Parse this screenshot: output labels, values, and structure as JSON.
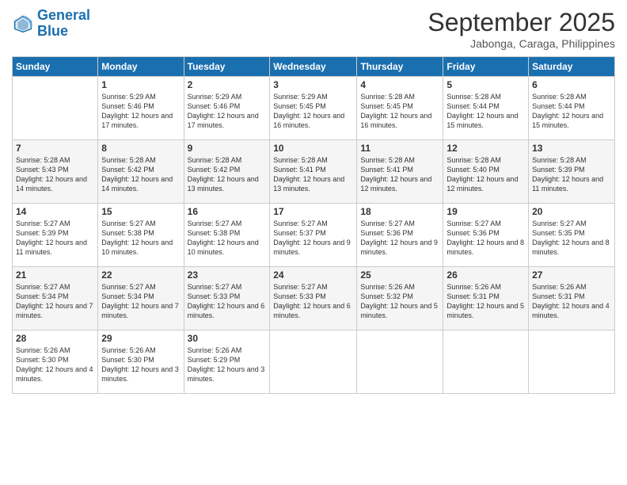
{
  "header": {
    "logo_line1": "General",
    "logo_line2": "Blue",
    "month": "September 2025",
    "location": "Jabonga, Caraga, Philippines"
  },
  "days_of_week": [
    "Sunday",
    "Monday",
    "Tuesday",
    "Wednesday",
    "Thursday",
    "Friday",
    "Saturday"
  ],
  "weeks": [
    [
      {
        "day": "",
        "sunrise": "",
        "sunset": "",
        "daylight": ""
      },
      {
        "day": "1",
        "sunrise": "Sunrise: 5:29 AM",
        "sunset": "Sunset: 5:46 PM",
        "daylight": "Daylight: 12 hours and 17 minutes."
      },
      {
        "day": "2",
        "sunrise": "Sunrise: 5:29 AM",
        "sunset": "Sunset: 5:46 PM",
        "daylight": "Daylight: 12 hours and 17 minutes."
      },
      {
        "day": "3",
        "sunrise": "Sunrise: 5:29 AM",
        "sunset": "Sunset: 5:45 PM",
        "daylight": "Daylight: 12 hours and 16 minutes."
      },
      {
        "day": "4",
        "sunrise": "Sunrise: 5:28 AM",
        "sunset": "Sunset: 5:45 PM",
        "daylight": "Daylight: 12 hours and 16 minutes."
      },
      {
        "day": "5",
        "sunrise": "Sunrise: 5:28 AM",
        "sunset": "Sunset: 5:44 PM",
        "daylight": "Daylight: 12 hours and 15 minutes."
      },
      {
        "day": "6",
        "sunrise": "Sunrise: 5:28 AM",
        "sunset": "Sunset: 5:44 PM",
        "daylight": "Daylight: 12 hours and 15 minutes."
      }
    ],
    [
      {
        "day": "7",
        "sunrise": "Sunrise: 5:28 AM",
        "sunset": "Sunset: 5:43 PM",
        "daylight": "Daylight: 12 hours and 14 minutes."
      },
      {
        "day": "8",
        "sunrise": "Sunrise: 5:28 AM",
        "sunset": "Sunset: 5:42 PM",
        "daylight": "Daylight: 12 hours and 14 minutes."
      },
      {
        "day": "9",
        "sunrise": "Sunrise: 5:28 AM",
        "sunset": "Sunset: 5:42 PM",
        "daylight": "Daylight: 12 hours and 13 minutes."
      },
      {
        "day": "10",
        "sunrise": "Sunrise: 5:28 AM",
        "sunset": "Sunset: 5:41 PM",
        "daylight": "Daylight: 12 hours and 13 minutes."
      },
      {
        "day": "11",
        "sunrise": "Sunrise: 5:28 AM",
        "sunset": "Sunset: 5:41 PM",
        "daylight": "Daylight: 12 hours and 12 minutes."
      },
      {
        "day": "12",
        "sunrise": "Sunrise: 5:28 AM",
        "sunset": "Sunset: 5:40 PM",
        "daylight": "Daylight: 12 hours and 12 minutes."
      },
      {
        "day": "13",
        "sunrise": "Sunrise: 5:28 AM",
        "sunset": "Sunset: 5:39 PM",
        "daylight": "Daylight: 12 hours and 11 minutes."
      }
    ],
    [
      {
        "day": "14",
        "sunrise": "Sunrise: 5:27 AM",
        "sunset": "Sunset: 5:39 PM",
        "daylight": "Daylight: 12 hours and 11 minutes."
      },
      {
        "day": "15",
        "sunrise": "Sunrise: 5:27 AM",
        "sunset": "Sunset: 5:38 PM",
        "daylight": "Daylight: 12 hours and 10 minutes."
      },
      {
        "day": "16",
        "sunrise": "Sunrise: 5:27 AM",
        "sunset": "Sunset: 5:38 PM",
        "daylight": "Daylight: 12 hours and 10 minutes."
      },
      {
        "day": "17",
        "sunrise": "Sunrise: 5:27 AM",
        "sunset": "Sunset: 5:37 PM",
        "daylight": "Daylight: 12 hours and 9 minutes."
      },
      {
        "day": "18",
        "sunrise": "Sunrise: 5:27 AM",
        "sunset": "Sunset: 5:36 PM",
        "daylight": "Daylight: 12 hours and 9 minutes."
      },
      {
        "day": "19",
        "sunrise": "Sunrise: 5:27 AM",
        "sunset": "Sunset: 5:36 PM",
        "daylight": "Daylight: 12 hours and 8 minutes."
      },
      {
        "day": "20",
        "sunrise": "Sunrise: 5:27 AM",
        "sunset": "Sunset: 5:35 PM",
        "daylight": "Daylight: 12 hours and 8 minutes."
      }
    ],
    [
      {
        "day": "21",
        "sunrise": "Sunrise: 5:27 AM",
        "sunset": "Sunset: 5:34 PM",
        "daylight": "Daylight: 12 hours and 7 minutes."
      },
      {
        "day": "22",
        "sunrise": "Sunrise: 5:27 AM",
        "sunset": "Sunset: 5:34 PM",
        "daylight": "Daylight: 12 hours and 7 minutes."
      },
      {
        "day": "23",
        "sunrise": "Sunrise: 5:27 AM",
        "sunset": "Sunset: 5:33 PM",
        "daylight": "Daylight: 12 hours and 6 minutes."
      },
      {
        "day": "24",
        "sunrise": "Sunrise: 5:27 AM",
        "sunset": "Sunset: 5:33 PM",
        "daylight": "Daylight: 12 hours and 6 minutes."
      },
      {
        "day": "25",
        "sunrise": "Sunrise: 5:26 AM",
        "sunset": "Sunset: 5:32 PM",
        "daylight": "Daylight: 12 hours and 5 minutes."
      },
      {
        "day": "26",
        "sunrise": "Sunrise: 5:26 AM",
        "sunset": "Sunset: 5:31 PM",
        "daylight": "Daylight: 12 hours and 5 minutes."
      },
      {
        "day": "27",
        "sunrise": "Sunrise: 5:26 AM",
        "sunset": "Sunset: 5:31 PM",
        "daylight": "Daylight: 12 hours and 4 minutes."
      }
    ],
    [
      {
        "day": "28",
        "sunrise": "Sunrise: 5:26 AM",
        "sunset": "Sunset: 5:30 PM",
        "daylight": "Daylight: 12 hours and 4 minutes."
      },
      {
        "day": "29",
        "sunrise": "Sunrise: 5:26 AM",
        "sunset": "Sunset: 5:30 PM",
        "daylight": "Daylight: 12 hours and 3 minutes."
      },
      {
        "day": "30",
        "sunrise": "Sunrise: 5:26 AM",
        "sunset": "Sunset: 5:29 PM",
        "daylight": "Daylight: 12 hours and 3 minutes."
      },
      {
        "day": "",
        "sunrise": "",
        "sunset": "",
        "daylight": ""
      },
      {
        "day": "",
        "sunrise": "",
        "sunset": "",
        "daylight": ""
      },
      {
        "day": "",
        "sunrise": "",
        "sunset": "",
        "daylight": ""
      },
      {
        "day": "",
        "sunrise": "",
        "sunset": "",
        "daylight": ""
      }
    ]
  ]
}
